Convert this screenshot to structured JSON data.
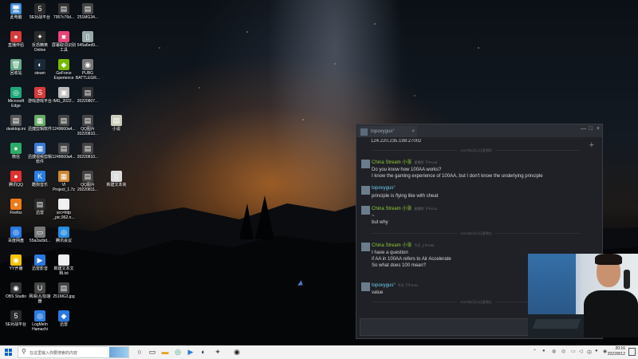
{
  "desktop_icons": [
    {
      "name": "icon-this-pc",
      "label": "此电脑",
      "glyph": "🖥",
      "color": "#3d8bd6"
    },
    {
      "name": "icon-5e-platform",
      "label": "5E对战平台",
      "glyph": "5",
      "color": "#2a2a2a"
    },
    {
      "name": "icon-file-7957",
      "label": "7957c76d...",
      "glyph": "▤",
      "color": "#333"
    },
    {
      "name": "icon-file-2511",
      "label": "251MG34...",
      "glyph": "▤",
      "color": "#444"
    },
    {
      "name": "icon-live-companion",
      "label": "直播伴侣",
      "glyph": "●",
      "color": "#d63b3b"
    },
    {
      "name": "icon-elite-online",
      "label": "反恐精英\nOnline",
      "glyph": "✦",
      "color": "#2b2b2b"
    },
    {
      "name": "icon-screen-tool",
      "label": "屏幕取词识别工具",
      "glyph": "■",
      "color": "#e8457a"
    },
    {
      "name": "icon-file-545a",
      "label": "545a6ed9...",
      "glyph": "▯",
      "color": "#9aa"
    },
    {
      "name": "icon-recycle-bin",
      "label": "回收站",
      "glyph": "🗑",
      "color": "#6a8"
    },
    {
      "name": "icon-steam",
      "label": "steam",
      "glyph": "◐",
      "color": "#1b2838"
    },
    {
      "name": "icon-geforce",
      "label": "GeForce\nExperience",
      "glyph": "◆",
      "color": "#76b900"
    },
    {
      "name": "icon-pubg",
      "label": "PUBG\nBATTLEGR...",
      "glyph": "◉",
      "color": "#777"
    },
    {
      "name": "icon-edge",
      "label": "Microsoft\nEdge",
      "glyph": "◎",
      "color": "#1fa67a"
    },
    {
      "name": "icon-game-platform",
      "label": "游戏游戏平台",
      "glyph": "S",
      "color": "#d63b3b"
    },
    {
      "name": "icon-img-2022",
      "label": "IMG_2022...",
      "glyph": "▣",
      "color": "#bbb"
    },
    {
      "name": "icon-file-20220807",
      "label": "20220807...",
      "glyph": "▤",
      "color": "#333"
    },
    {
      "name": "icon-desktop-ini",
      "label": "desktop.ini",
      "glyph": "▤",
      "color": "#555"
    },
    {
      "name": "icon-video-editor",
      "label": "迅捷剪辑软件",
      "glyph": "▦",
      "color": "#6a6"
    },
    {
      "name": "icon-file-1249",
      "label": "1249660a4...",
      "glyph": "▤",
      "color": "#444"
    },
    {
      "name": "icon-qq-image",
      "label": "QQ图片\n20220810...",
      "glyph": "▤",
      "color": "#444"
    },
    {
      "name": "icon-small-game",
      "label": "小说",
      "glyph": "▤",
      "color": "#ccb"
    },
    {
      "name": "icon-wechat",
      "label": "微信",
      "glyph": "●",
      "color": "#2aae67"
    },
    {
      "name": "icon-video-converter",
      "label": "迅捷视频剪辑软件",
      "glyph": "▦",
      "color": "#3a7bd5"
    },
    {
      "name": "icon-file-1249b",
      "label": "1249660a4...",
      "glyph": "▤",
      "color": "#444"
    },
    {
      "name": "icon-file-20220810",
      "label": "20220810...",
      "glyph": "▤",
      "color": "#444"
    },
    {
      "name": "icon-tencent-qq",
      "label": "腾讯QQ",
      "glyph": "●",
      "color": "#e03030"
    },
    {
      "name": "icon-kugou-music",
      "label": "酷狗音乐",
      "glyph": "K",
      "color": "#2a7de1"
    },
    {
      "name": "icon-vi-project",
      "label": "VI\nProject_1.7z",
      "glyph": "▦",
      "color": "#c83"
    },
    {
      "name": "icon-qq-image-2",
      "label": "QQ图片\n20220811...",
      "glyph": "▤",
      "color": "#444"
    },
    {
      "name": "icon-new-text",
      "label": "新建文本夹",
      "glyph": "▯",
      "color": "#ddd"
    },
    {
      "name": "icon-firefox",
      "label": "Firefox",
      "glyph": "●",
      "color": "#f07a1a"
    },
    {
      "name": "icon-xunlei",
      "label": "迅雷",
      "glyph": "▤",
      "color": "#2a2a2a"
    },
    {
      "name": "icon-src-http",
      "label": "src=http\n_pic.962.n...",
      "glyph": "▯",
      "color": "#eee"
    },
    {
      "name": "icon-baidu-netdisk",
      "label": "百度网盘",
      "glyph": "◎",
      "color": "#2a78e0"
    },
    {
      "name": "icon-55a2",
      "label": "55a2acbd...",
      "glyph": "▭",
      "color": "#777"
    },
    {
      "name": "icon-tencent-meeting",
      "label": "腾讯会议",
      "glyph": "◎",
      "color": "#2a8de0"
    },
    {
      "name": "icon-yy",
      "label": "YY开播",
      "glyph": "◉",
      "color": "#f5c400"
    },
    {
      "name": "icon-xunlei-video",
      "label": "迅雷影音",
      "glyph": "▶",
      "color": "#2a78e0"
    },
    {
      "name": "icon-new-doc",
      "label": "新建文本文\n档.txt",
      "glyph": "▯",
      "color": "#eee"
    },
    {
      "name": "icon-obs",
      "label": "OBS Studio",
      "glyph": "◉",
      "color": "#333"
    },
    {
      "name": "icon-uu",
      "label": "网易UU加速器",
      "glyph": "U",
      "color": "#444"
    },
    {
      "name": "icon-251mg",
      "label": "251MG3.jpg",
      "glyph": "▤",
      "color": "#444"
    },
    {
      "name": "icon-5e-platform-2",
      "label": "5E对战平台",
      "glyph": "5",
      "color": "#2a2a2a"
    },
    {
      "name": "icon-logmein",
      "label": "LogMeIn\nHamachi",
      "glyph": "◎",
      "color": "#2a7de1"
    },
    {
      "name": "icon-xunlei-2",
      "label": "迅雷",
      "glyph": "◆",
      "color": "#2a78e0"
    }
  ],
  "chat": {
    "tab_name": "topovygus°",
    "ip_line": "124.220.235.198:27002",
    "day_sep_1": "2022年8月11日星期四",
    "day_sep_2": "2022年8月12日星期五",
    "day_sep_3": "2022年8月12日星期五",
    "g1": {
      "name": "China Stream 小张",
      "time": "星期四 下午6:28",
      "lines": [
        "Do you know how 100AA works?",
        "I know the gaming experience of 100AA, but I don't know the underlying principle"
      ]
    },
    "g2": {
      "name": "topovygus°",
      "time": "",
      "lines": [
        "principle is flying like with cheat"
      ]
    },
    "g3": {
      "name": "China Stream 小张",
      "time": "星期四 下午6:31",
      "lines": [
        "~",
        "but why"
      ]
    },
    "g4": {
      "name": "China Stream 小张",
      "time": "今天 上午8:55",
      "lines": [
        "I have a question",
        "if AA in 100AA refers to Air Accelerate",
        "So what does 100 mean?"
      ]
    },
    "g5": {
      "name": "topovygus°",
      "time": "今天 下午8:30",
      "lines": [
        "value"
      ]
    }
  },
  "taskbar": {
    "search_placeholder": "在这里输入你要搜索的内容",
    "time": "20:16",
    "date": "2022/8/12"
  },
  "colors": {
    "chat_bg": "#1f2126",
    "name_blue": "#6dcff6",
    "name_green": "#8fc93a"
  }
}
